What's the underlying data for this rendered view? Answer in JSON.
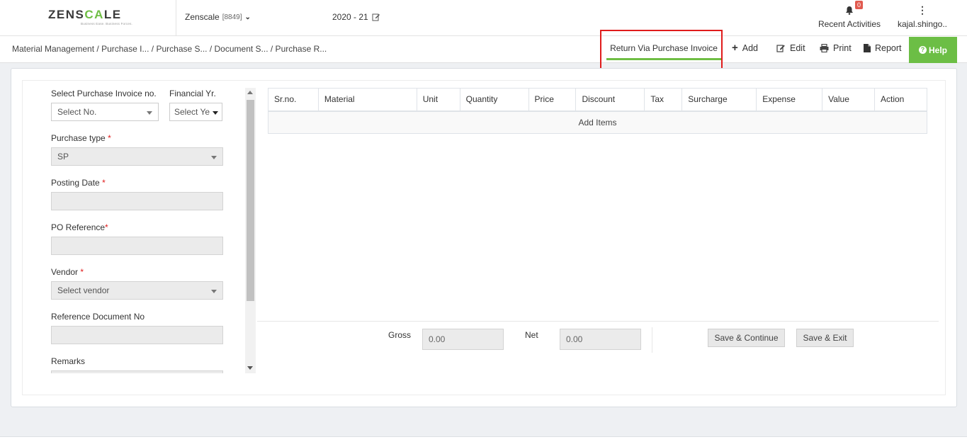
{
  "header": {
    "logo": {
      "word": "ZENSCALE",
      "tagline": "Business Ease. Business Forces."
    },
    "company": {
      "name": "Zenscale",
      "code": "[8849]"
    },
    "financial_year": "2020 - 21",
    "notifications": {
      "count": "0",
      "label": "Recent Activities"
    },
    "user": {
      "name": "kajal.shingo.."
    }
  },
  "breadcrumb": {
    "items": [
      "Material Management",
      "/ Purchase I...",
      "/ Purchase S...",
      "/ Document S...",
      "/ Purchase R..."
    ]
  },
  "toolbar": {
    "active_tab": "Return Via Purchase Invoice",
    "add": "Add",
    "edit": "Edit",
    "print": "Print",
    "report": "Report",
    "help": "Help"
  },
  "form": {
    "purchase_invoice_label": "Select Purchase Invoice no.",
    "purchase_invoice_value": "Select No.",
    "financial_yr_label": "Financial Yr.",
    "financial_yr_value": "Select Ye",
    "purchase_type_label": "Purchase type",
    "purchase_type_value": "SP",
    "posting_date_label": "Posting Date",
    "posting_date_value": "",
    "po_reference_label": "PO Reference",
    "po_reference_value": "",
    "vendor_label": "Vendor",
    "vendor_value": "Select vendor",
    "reference_doc_label": "Reference Document No",
    "reference_doc_value": "",
    "remarks_label": "Remarks",
    "required_mark": "*"
  },
  "table": {
    "columns": [
      "Sr.no.",
      "Material",
      "Unit",
      "Quantity",
      "Price",
      "Discount",
      "Tax",
      "Surcharge",
      "Expense",
      "Value",
      "Action"
    ],
    "add_items": "Add Items"
  },
  "footer": {
    "gross_label": "Gross",
    "gross_value": "0.00",
    "net_label": "Net",
    "net_value": "0.00",
    "save_continue": "Save & Continue",
    "save_exit": "Save & Exit"
  },
  "colors": {
    "accent": "#6cbe45",
    "highlight": "#e01c1c",
    "badge": "#e15a4f"
  }
}
